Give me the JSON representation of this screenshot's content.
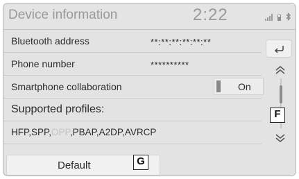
{
  "header": {
    "title": "Device information",
    "clock": "2:22",
    "status_icons": [
      "signal-icon",
      "battery-icon",
      "bluetooth-icon"
    ]
  },
  "rows": {
    "bluetooth_address": {
      "label": "Bluetooth address",
      "value": "**:**:**:**:**:**"
    },
    "phone_number": {
      "label": "Phone number",
      "value": "**********"
    },
    "smartphone_collaboration": {
      "label": "Smartphone collaboration",
      "toggle_state": "On"
    },
    "supported_profiles": {
      "label": "Supported profiles:",
      "value_part1": "HFP,SPP,",
      "value_faded": "OPP",
      "value_part2": ",PBAP,A2DP,AVRCP"
    }
  },
  "buttons": {
    "back_icon": "back-arrow-icon",
    "scroll_up_icon": "chevron-up-icon",
    "scroll_down_icon": "chevron-down-icon",
    "default_label": "Default"
  },
  "callouts": {
    "f": "F",
    "g": "G"
  },
  "colors": {
    "screen_background": "#e3e3e3",
    "header_text": "#9a9a9a",
    "body_text": "#2b2b2b",
    "faded_text": "#c4c4c4",
    "toggle_indicator": "#888888"
  }
}
